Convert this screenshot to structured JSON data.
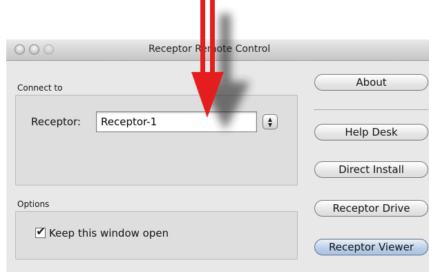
{
  "window": {
    "title": "Receptor Remote Control"
  },
  "connect_group": {
    "label": "Connect to",
    "receptor_label": "Receptor:",
    "receptor_value": "Receptor-1"
  },
  "options_group": {
    "label": "Options",
    "keep_open_label": "Keep this window open",
    "keep_open_checked": true
  },
  "buttons": {
    "about": "About",
    "help_desk": "Help Desk",
    "direct_install": "Direct Install",
    "receptor_drive": "Receptor Drive",
    "receptor_viewer": "Receptor Viewer"
  },
  "annotation": {
    "arrow_color": "#e41e1e",
    "arrow_icon": "red-down-arrow-icon"
  }
}
